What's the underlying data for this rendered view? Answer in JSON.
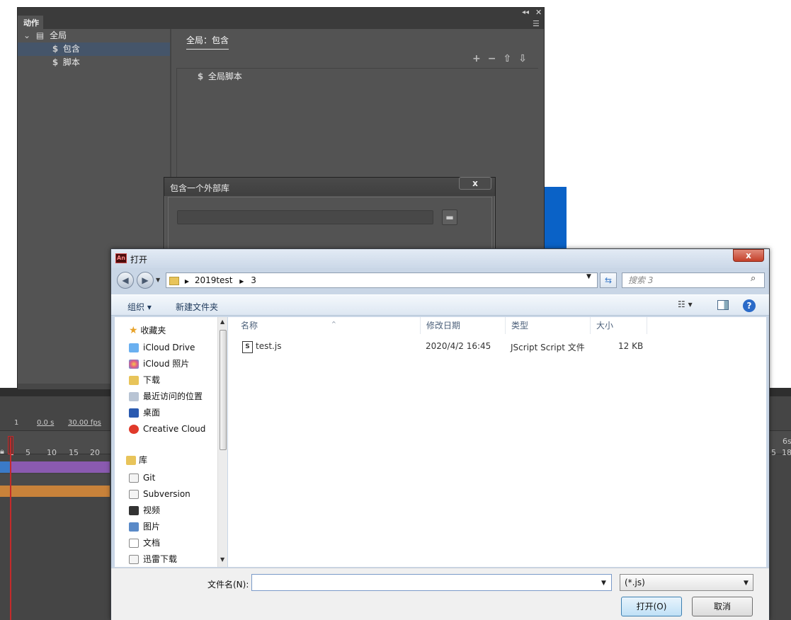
{
  "timeline": {
    "frame": "1",
    "time": "0.0 s",
    "fps": "30.00 fps",
    "ruler_ticks": [
      "1",
      "5",
      "10",
      "15",
      "20"
    ],
    "right_ticks": [
      "6s",
      "5",
      "18"
    ]
  },
  "actions_panel": {
    "tab": "动作",
    "tree": {
      "root": "全局",
      "items": [
        "包含",
        "脚本"
      ]
    },
    "heading": "全局：包含",
    "tools": "+ − ⇧ ⇩",
    "list_item": "全局脚本"
  },
  "include_dialog": {
    "title": "包含一个外部库",
    "close": "x"
  },
  "open_dialog": {
    "title": "打开",
    "app_icon": "An",
    "close": "x",
    "path": [
      "2019test",
      "3"
    ],
    "search_placeholder": "搜索 3",
    "toolbar": {
      "organize": "组织 ▾",
      "new_folder": "新建文件夹"
    },
    "nav": {
      "favorites_header": "收藏夹",
      "favorites": [
        "iCloud Drive",
        "iCloud 照片",
        "下载",
        "最近访问的位置",
        "桌面",
        "Creative Cloud"
      ],
      "library_header": "库",
      "libraries": [
        "Git",
        "Subversion",
        "视频",
        "图片",
        "文档",
        "迅雷下载"
      ]
    },
    "columns": [
      "名称",
      "修改日期",
      "类型",
      "大小"
    ],
    "files": [
      {
        "name": "test.js",
        "modified": "2020/4/2 16:45",
        "type": "JScript Script 文件",
        "size": "12 KB"
      }
    ],
    "filename_label": "文件名(N):",
    "filename_value": "",
    "filetype": "(*.js)",
    "open_button": "打开(O)",
    "cancel_button": "取消"
  },
  "colors": {
    "panel_bg": "#535353",
    "selection": "#45556a",
    "dialog_frame": "#c9d6e6",
    "accent_blue": "#0a62c7"
  }
}
